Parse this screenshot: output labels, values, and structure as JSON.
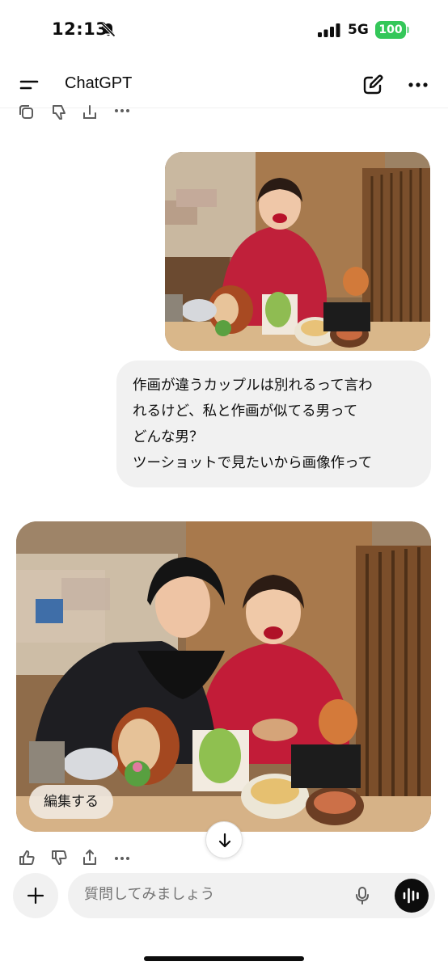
{
  "status_bar": {
    "time": "12:13",
    "network": "5G",
    "battery": "100",
    "battery_color": "#34c759"
  },
  "header": {
    "title": "ChatGPT",
    "icons": [
      "menu-icon",
      "new-chat-icon",
      "more-icon"
    ]
  },
  "conversation": {
    "user_message": {
      "lines": [
        "作画が違うカップルは別れるって言わ",
        "れるけど、私と作画が似てる男って",
        "どんな男？",
        "ツーショットで見たいから画像作って"
      ]
    },
    "generated_image": {
      "edit_label": "編集する"
    },
    "message_actions": [
      "copy-icon",
      "thumbs-up-icon",
      "thumbs-down-icon",
      "share-icon",
      "more-icon"
    ]
  },
  "composer": {
    "placeholder": "質問してみましょう"
  },
  "colors": {
    "bubble_bg": "#f1f1f1",
    "text": "#0d0d0d",
    "placeholder": "#9a9a9a"
  }
}
